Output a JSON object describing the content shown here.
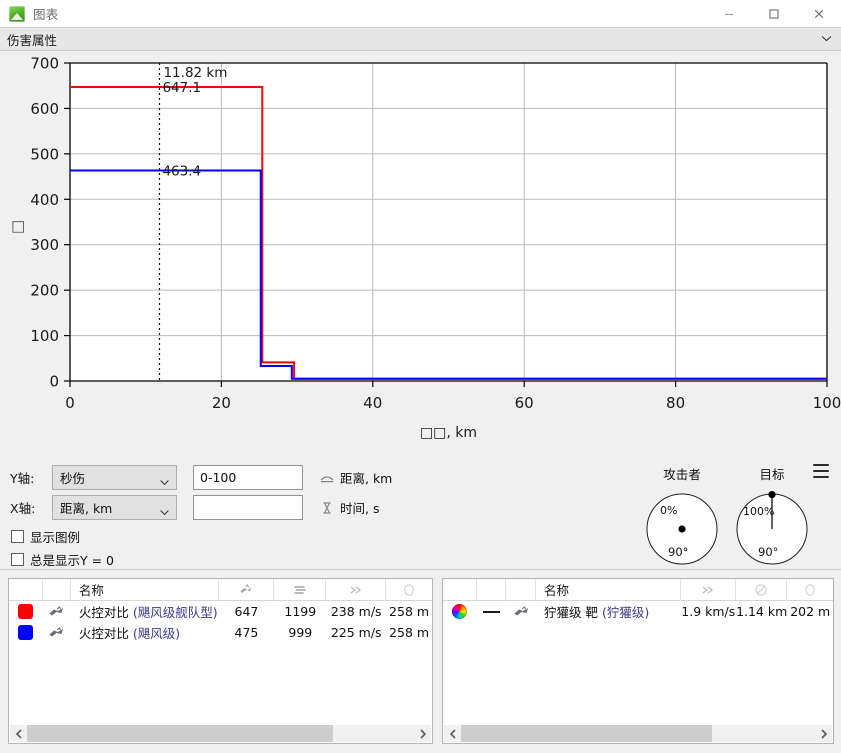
{
  "window": {
    "title": "图表",
    "icon": "chart-app-icon",
    "minimize": "−",
    "maximize": "□",
    "close": "✕"
  },
  "section": {
    "title": "伤害属性",
    "chevron": "chevron-down-icon"
  },
  "chart_data": {
    "type": "line",
    "title": "",
    "xlabel": "距离, km",
    "xlabel_rendered": "□□, km",
    "ylabel_rendered": "□",
    "xlim": [
      0,
      100
    ],
    "ylim": [
      0,
      700
    ],
    "xticks": [
      0,
      20,
      40,
      60,
      80,
      100
    ],
    "yticks": [
      0,
      100,
      200,
      300,
      400,
      500,
      600,
      700
    ],
    "grid": true,
    "legend": false,
    "annotations": [
      {
        "name": "cursor-distance",
        "text": "11.82 km",
        "x": 11.82
      },
      {
        "name": "red-value",
        "text": "647.1",
        "x": 11.82,
        "y": 647.1,
        "color": "#ff0000"
      },
      {
        "name": "blue-value",
        "text": "463.4",
        "x": 11.82,
        "y": 463.4,
        "color": "#0000ff"
      }
    ],
    "cursor_x": 11.82,
    "series": [
      {
        "name": "火控对比 (飓风级舰队型)",
        "color": "#ff0000",
        "x": [
          0,
          25.4,
          25.4,
          28.6,
          28.6,
          29.6,
          29.6,
          100
        ],
        "y": [
          647.1,
          647.1,
          41,
          41,
          41,
          41,
          5,
          5
        ]
      },
      {
        "name": "火控对比 (飓风级)",
        "color": "#0000ff",
        "x": [
          0,
          25.2,
          25.2,
          29.3,
          29.3,
          100
        ],
        "y": [
          463.4,
          463.4,
          33,
          33,
          5,
          5
        ]
      }
    ]
  },
  "controls": {
    "y_axis": {
      "label": "Y轴:",
      "selected": "秒伤",
      "range_value": "0-100",
      "range_placeholder": "",
      "unit_icon": "distance-icon",
      "unit_text": "距离, km"
    },
    "x_axis": {
      "label": "X轴:",
      "selected": "距离, km",
      "range_value": "",
      "range_placeholder": "",
      "unit_icon": "time-icon",
      "unit_text": "时间, s"
    },
    "checkboxes": [
      {
        "name": "show-legend",
        "label": "显示图例",
        "checked": false
      },
      {
        "name": "always-show-y-zero",
        "label": "总是显示Y = 0",
        "checked": false
      }
    ],
    "gauges": [
      {
        "name": "attacker",
        "title": "攻击者",
        "percent": "0%",
        "angle": "90°",
        "needle": false
      },
      {
        "name": "target",
        "title": "目标",
        "percent": "100%",
        "angle": "90°",
        "needle": true
      }
    ],
    "menu_icon": "hamburger-menu-icon"
  },
  "left_table": {
    "columns": [
      {
        "name": "color-swatch",
        "label": "",
        "icon": ""
      },
      {
        "name": "ship-icon",
        "label": "",
        "icon": ""
      },
      {
        "name": "name",
        "label": "名称",
        "icon": ""
      },
      {
        "name": "alpha-damage",
        "label": "",
        "icon": "burst-damage-icon"
      },
      {
        "name": "dps",
        "label": "",
        "icon": "dps-icon"
      },
      {
        "name": "speed",
        "label": "",
        "icon": "speed-icon"
      },
      {
        "name": "signature",
        "label": "",
        "icon": "signature-icon"
      }
    ],
    "rows": [
      {
        "color": "#ff0000",
        "name_main": "火控对比",
        "name_sub": "(飓风级舰队型)",
        "alpha": "647",
        "dps": "1199",
        "speed": "238 m/s",
        "signature": "258 m"
      },
      {
        "color": "#0000ff",
        "name_main": "火控对比",
        "name_sub": "(飓风级)",
        "alpha": "475",
        "dps": "999",
        "speed": "225 m/s",
        "signature": "258 m"
      }
    ],
    "scrollbar": {
      "left_arrow": "❮",
      "right_arrow": "❯",
      "thumb_percent": 79
    }
  },
  "right_table": {
    "columns": [
      {
        "name": "color-wheel",
        "label": "",
        "icon": ""
      },
      {
        "name": "line-style",
        "label": "",
        "icon": ""
      },
      {
        "name": "ship-icon",
        "label": "",
        "icon": ""
      },
      {
        "name": "name",
        "label": "名称",
        "icon": ""
      },
      {
        "name": "speed",
        "label": "",
        "icon": "speed-icon"
      },
      {
        "name": "orbit-range",
        "label": "",
        "icon": "orbit-icon"
      },
      {
        "name": "signature",
        "label": "",
        "icon": "signature-icon"
      }
    ],
    "rows": [
      {
        "name_main": "狞獾级 靶",
        "name_sub": "(狞獾级)",
        "speed": "1.9 km/s",
        "orbit": "1.14 km",
        "signature": "202 m"
      }
    ],
    "scrollbar": {
      "left_arrow": "❮",
      "right_arrow": "❯",
      "thumb_percent": 71
    }
  },
  "colors": {
    "series_red": "#ff0000",
    "series_blue": "#0000ff",
    "panel_bg": "#f0f0f0",
    "header_bg": "#e7e7e7"
  }
}
